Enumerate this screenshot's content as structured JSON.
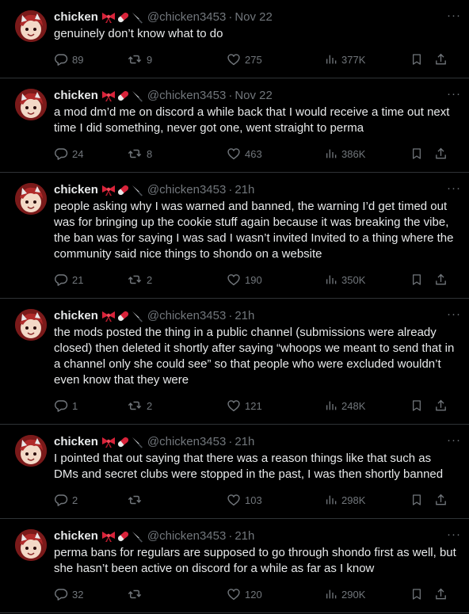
{
  "colors": {
    "background": "#000000",
    "text": "#e7e9ea",
    "muted": "#71767b",
    "divider": "#2f3336"
  },
  "more_label": "···",
  "tweets": [
    {
      "name": "chicken",
      "handle": "@chicken3453",
      "dot": "·",
      "time": "Nov 22",
      "text": "genuinely don’t know what to do",
      "replies": "89",
      "retweets": "9",
      "likes": "275",
      "views": "377K"
    },
    {
      "name": "chicken",
      "handle": "@chicken3453",
      "dot": "·",
      "time": "Nov 22",
      "text": "a mod dm’d me on discord a while back that I would receive a time out next time I did something, never got one, went straight to perma",
      "replies": "24",
      "retweets": "8",
      "likes": "463",
      "views": "386K"
    },
    {
      "name": "chicken",
      "handle": "@chicken3453",
      "dot": "·",
      "time": "21h",
      "text": "people asking why I was warned and banned, the warning I’d get timed out was for bringing up the cookie stuff again because it was breaking the vibe, the ban was for saying I was sad I wasn’t invited Invited to a thing where the community said nice things to shondo on a website",
      "replies": "21",
      "retweets": "2",
      "likes": "190",
      "views": "350K"
    },
    {
      "name": "chicken",
      "handle": "@chicken3453",
      "dot": "·",
      "time": "21h",
      "text": "the mods posted the thing in a public channel (submissions were already closed) then deleted it shortly after saying “whoops we meant to send that in a channel only she could see” so that people who were excluded wouldn’t even know that they were",
      "replies": "1",
      "retweets": "2",
      "likes": "121",
      "views": "248K"
    },
    {
      "name": "chicken",
      "handle": "@chicken3453",
      "dot": "·",
      "time": "21h",
      "text": "I pointed that out saying that there was a reason things like that such as DMs and secret clubs were stopped in the past, I was then shortly banned",
      "replies": "2",
      "retweets": "",
      "likes": "103",
      "views": "298K"
    },
    {
      "name": "chicken",
      "handle": "@chicken3453",
      "dot": "·",
      "time": "21h",
      "text": "perma bans for regulars are supposed to go through shondo first as well, but she hasn’t been active on discord for a while as far as I know",
      "replies": "32",
      "retweets": "",
      "likes": "120",
      "views": "290K"
    }
  ]
}
